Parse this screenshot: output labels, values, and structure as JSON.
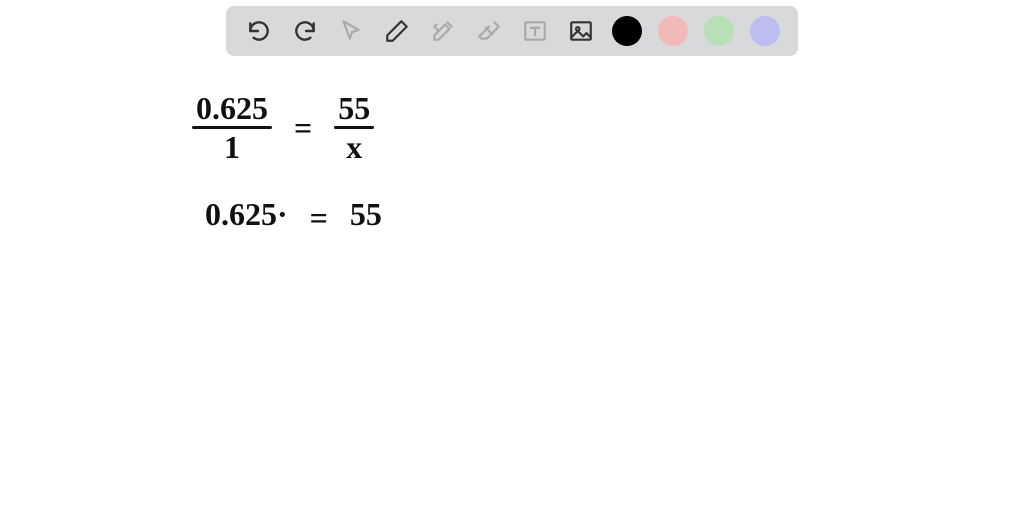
{
  "toolbar": {
    "icons": {
      "undo": "undo-icon",
      "redo": "redo-icon",
      "cursor": "cursor-icon",
      "pencil": "pencil-icon",
      "tools": "tools-icon",
      "eraser": "eraser-icon",
      "text": "text-box-icon",
      "image": "image-icon"
    },
    "colors": {
      "black": "#000000",
      "pink": "#f3b9b9",
      "green": "#b7e0b7",
      "purple": "#bdbdf2"
    }
  },
  "handwriting": {
    "line1": {
      "frac1_num": "0.625",
      "frac1_den": "1",
      "equals": "=",
      "frac2_num": "55",
      "frac2_den": "x"
    },
    "line2": {
      "lhs": "0.625·",
      "equals": "=",
      "rhs": "55"
    }
  }
}
